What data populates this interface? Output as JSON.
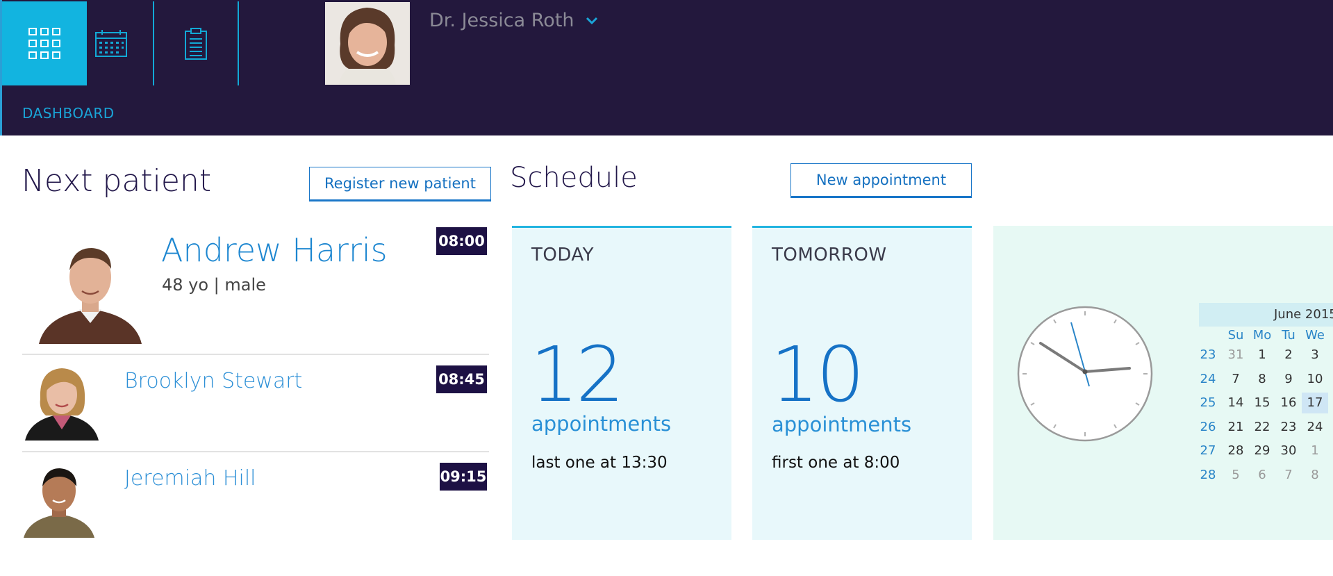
{
  "header": {
    "nav": [
      {
        "name": "dashboard-tile",
        "icon": "grid-icon"
      },
      {
        "name": "calendar-tile",
        "icon": "calendar-icon"
      },
      {
        "name": "clipboard-tile",
        "icon": "clipboard-icon"
      }
    ],
    "doctor_name": "Dr. Jessica Roth",
    "page_label": "DASHBOARD"
  },
  "next_patient": {
    "title": "Next patient",
    "register_label": "Register new patient",
    "featured": {
      "name": "Andrew Harris",
      "info": "48 yo | male",
      "time": "08:00"
    },
    "list": [
      {
        "name": "Brooklyn Stewart",
        "time": "08:45"
      },
      {
        "name": "Jeremiah Hill",
        "time": "09:15"
      }
    ]
  },
  "schedule": {
    "title": "Schedule",
    "new_label": "New appointment",
    "today": {
      "label": "TODAY",
      "count": "12",
      "unit": "appointments",
      "note": "last one at 13:30"
    },
    "tomorrow": {
      "label": "TOMORROW",
      "count": "10",
      "unit": "appointments",
      "note": "first one at 8:00"
    }
  },
  "calendar": {
    "month": "June 2015",
    "days": [
      "Su",
      "Mo",
      "Tu",
      "We"
    ],
    "weeks": [
      {
        "wk": "23",
        "dates": [
          "31",
          "1",
          "2",
          "3"
        ]
      },
      {
        "wk": "24",
        "dates": [
          "7",
          "8",
          "9",
          "10"
        ]
      },
      {
        "wk": "25",
        "dates": [
          "14",
          "15",
          "16",
          "17"
        ]
      },
      {
        "wk": "26",
        "dates": [
          "21",
          "22",
          "23",
          "24"
        ]
      },
      {
        "wk": "27",
        "dates": [
          "28",
          "29",
          "30",
          "1"
        ]
      },
      {
        "wk": "28",
        "dates": [
          "5",
          "6",
          "7",
          "8"
        ]
      }
    ]
  },
  "colors": {
    "header_bg": "#23183d",
    "accent": "#12b4e0",
    "link_blue": "#1470c0",
    "badge_bg": "#1d1144",
    "card_bg": "#e8f8fb"
  }
}
